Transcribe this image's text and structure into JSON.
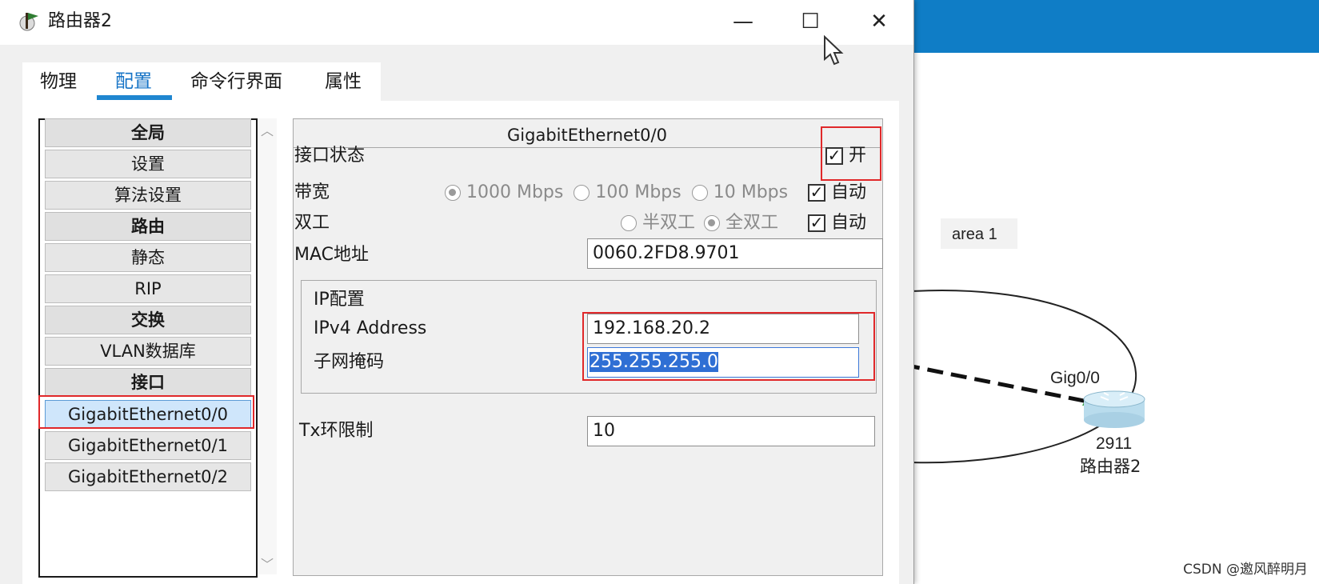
{
  "window": {
    "title": "路由器2",
    "minimize": "—",
    "maximize": "☐",
    "close": "✕"
  },
  "tabs": [
    {
      "label": "物理"
    },
    {
      "label": "配置"
    },
    {
      "label": "命令行界面"
    },
    {
      "label": "属性"
    }
  ],
  "sidebar": {
    "items": [
      {
        "label": "全局",
        "type": "header"
      },
      {
        "label": "设置"
      },
      {
        "label": "算法设置"
      },
      {
        "label": "路由",
        "type": "header"
      },
      {
        "label": "静态"
      },
      {
        "label": "RIP"
      },
      {
        "label": "交换",
        "type": "header"
      },
      {
        "label": "VLAN数据库"
      },
      {
        "label": "接口",
        "type": "header"
      },
      {
        "label": "GigabitEthernet0/0",
        "selected": true
      },
      {
        "label": "GigabitEthernet0/1"
      },
      {
        "label": "GigabitEthernet0/2"
      }
    ]
  },
  "interface": {
    "title": "GigabitEthernet0/0",
    "port_status_label": "接口状态",
    "port_status_value": "开",
    "bandwidth_label": "带宽",
    "bandwidth_options": [
      "1000 Mbps",
      "100 Mbps",
      "10 Mbps"
    ],
    "bandwidth_auto": "自动",
    "duplex_label": "双工",
    "duplex_options": [
      "半双工",
      "全双工"
    ],
    "duplex_auto": "自动",
    "mac_label": "MAC地址",
    "mac_value": "0060.2FD8.9701",
    "ip_config_label": "IP配置",
    "ipv4_label": "IPv4 Address",
    "ipv4_value": "192.168.20.2",
    "subnet_label": "子网掩码",
    "subnet_value": "255.255.255.0",
    "tx_label": "Tx环限制",
    "tx_value": "10"
  },
  "topology": {
    "area_label": "area 1",
    "port_label": "Gig0/0",
    "router_model": "2911",
    "router_name": "路由器2"
  },
  "watermark": "CSDN @邀风醉明月",
  "colors": {
    "accent": "#1f86d0",
    "highlight_box": "#e0282a",
    "link_light": "#3aa34a",
    "top_bar": "#0f7dc6"
  }
}
